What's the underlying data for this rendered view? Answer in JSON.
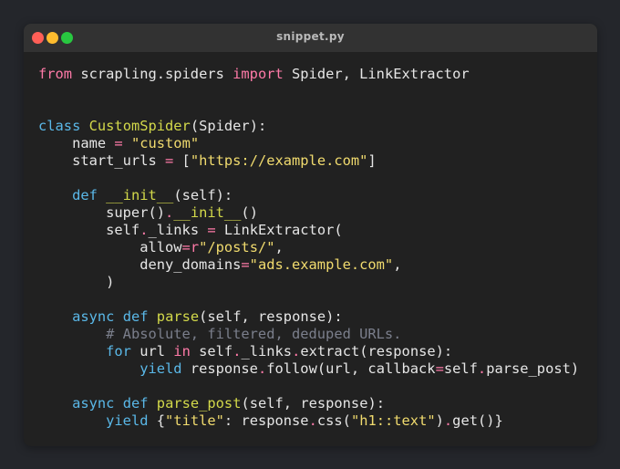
{
  "window": {
    "title": "snippet.py"
  },
  "colors": {
    "keyword": "#ff7aa8",
    "keyword_blue": "#5ab8e8",
    "function": "#d3d94a",
    "string": "#f1db6e",
    "comment": "#7b7f8c",
    "plain": "#e6e6e6",
    "operator": "#ff7aa8"
  },
  "code": {
    "lines": [
      [
        {
          "t": "from",
          "c": "keyword"
        },
        {
          "t": " scrapling.spiders ",
          "c": "plain"
        },
        {
          "t": "import",
          "c": "keyword"
        },
        {
          "t": " Spider, LinkExtractor",
          "c": "plain"
        }
      ],
      [],
      [],
      [
        {
          "t": "class",
          "c": "keyword_blue"
        },
        {
          "t": " ",
          "c": "plain"
        },
        {
          "t": "CustomSpider",
          "c": "function"
        },
        {
          "t": "(Spider):",
          "c": "plain"
        }
      ],
      [
        {
          "t": "    name ",
          "c": "plain"
        },
        {
          "t": "=",
          "c": "operator"
        },
        {
          "t": " ",
          "c": "plain"
        },
        {
          "t": "\"custom\"",
          "c": "string"
        }
      ],
      [
        {
          "t": "    start_urls ",
          "c": "plain"
        },
        {
          "t": "=",
          "c": "operator"
        },
        {
          "t": " [",
          "c": "plain"
        },
        {
          "t": "\"https://example.com\"",
          "c": "string"
        },
        {
          "t": "]",
          "c": "plain"
        }
      ],
      [],
      [
        {
          "t": "    ",
          "c": "plain"
        },
        {
          "t": "def",
          "c": "keyword_blue"
        },
        {
          "t": " ",
          "c": "plain"
        },
        {
          "t": "__init__",
          "c": "function"
        },
        {
          "t": "(self):",
          "c": "plain"
        }
      ],
      [
        {
          "t": "        super()",
          "c": "plain"
        },
        {
          "t": ".",
          "c": "operator"
        },
        {
          "t": "__init__",
          "c": "function"
        },
        {
          "t": "()",
          "c": "plain"
        }
      ],
      [
        {
          "t": "        self",
          "c": "plain"
        },
        {
          "t": ".",
          "c": "operator"
        },
        {
          "t": "_links ",
          "c": "plain"
        },
        {
          "t": "=",
          "c": "operator"
        },
        {
          "t": " LinkExtractor(",
          "c": "plain"
        }
      ],
      [
        {
          "t": "            allow",
          "c": "plain"
        },
        {
          "t": "=",
          "c": "operator"
        },
        {
          "t": "r",
          "c": "keyword"
        },
        {
          "t": "\"/posts/\"",
          "c": "string"
        },
        {
          "t": ",",
          "c": "plain"
        }
      ],
      [
        {
          "t": "            deny_domains",
          "c": "plain"
        },
        {
          "t": "=",
          "c": "operator"
        },
        {
          "t": "\"ads.example.com\"",
          "c": "string"
        },
        {
          "t": ",",
          "c": "plain"
        }
      ],
      [
        {
          "t": "        )",
          "c": "plain"
        }
      ],
      [],
      [
        {
          "t": "    ",
          "c": "plain"
        },
        {
          "t": "async",
          "c": "keyword_blue"
        },
        {
          "t": " ",
          "c": "plain"
        },
        {
          "t": "def",
          "c": "keyword_blue"
        },
        {
          "t": " ",
          "c": "plain"
        },
        {
          "t": "parse",
          "c": "function"
        },
        {
          "t": "(self, response):",
          "c": "plain"
        }
      ],
      [
        {
          "t": "        ",
          "c": "plain"
        },
        {
          "t": "# Absolute, filtered, deduped URLs.",
          "c": "comment"
        }
      ],
      [
        {
          "t": "        ",
          "c": "plain"
        },
        {
          "t": "for",
          "c": "keyword_blue"
        },
        {
          "t": " url ",
          "c": "plain"
        },
        {
          "t": "in",
          "c": "keyword"
        },
        {
          "t": " self",
          "c": "plain"
        },
        {
          "t": ".",
          "c": "operator"
        },
        {
          "t": "_links",
          "c": "plain"
        },
        {
          "t": ".",
          "c": "operator"
        },
        {
          "t": "extract(response):",
          "c": "plain"
        }
      ],
      [
        {
          "t": "            ",
          "c": "plain"
        },
        {
          "t": "yield",
          "c": "keyword_blue"
        },
        {
          "t": " response",
          "c": "plain"
        },
        {
          "t": ".",
          "c": "operator"
        },
        {
          "t": "follow(url, callback",
          "c": "plain"
        },
        {
          "t": "=",
          "c": "operator"
        },
        {
          "t": "self",
          "c": "plain"
        },
        {
          "t": ".",
          "c": "operator"
        },
        {
          "t": "parse_post)",
          "c": "plain"
        }
      ],
      [],
      [
        {
          "t": "    ",
          "c": "plain"
        },
        {
          "t": "async",
          "c": "keyword_blue"
        },
        {
          "t": " ",
          "c": "plain"
        },
        {
          "t": "def",
          "c": "keyword_blue"
        },
        {
          "t": " ",
          "c": "plain"
        },
        {
          "t": "parse_post",
          "c": "function"
        },
        {
          "t": "(self, response):",
          "c": "plain"
        }
      ],
      [
        {
          "t": "        ",
          "c": "plain"
        },
        {
          "t": "yield",
          "c": "keyword_blue"
        },
        {
          "t": " {",
          "c": "plain"
        },
        {
          "t": "\"title\"",
          "c": "string"
        },
        {
          "t": ": response",
          "c": "plain"
        },
        {
          "t": ".",
          "c": "operator"
        },
        {
          "t": "css(",
          "c": "plain"
        },
        {
          "t": "\"h1::text\"",
          "c": "string"
        },
        {
          "t": ")",
          "c": "plain"
        },
        {
          "t": ".",
          "c": "operator"
        },
        {
          "t": "get()}",
          "c": "plain"
        }
      ]
    ]
  }
}
